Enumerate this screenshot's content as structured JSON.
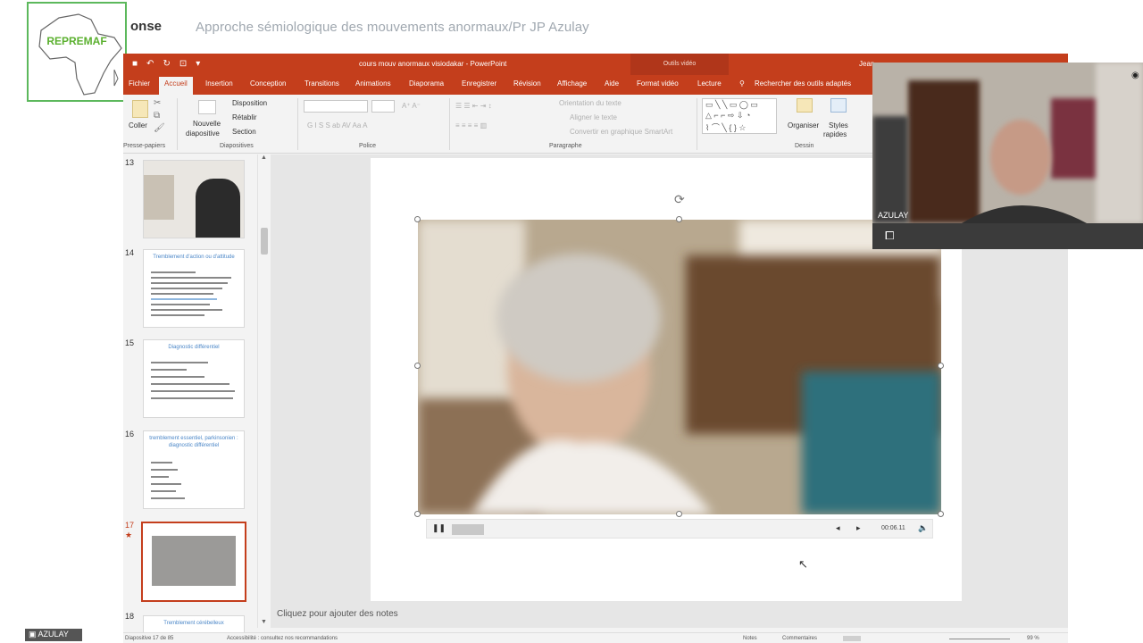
{
  "meeting": {
    "logo_text": "REPREMAF",
    "brand_fragment": "onse",
    "title": "Approche sémiologique des mouvements anormaux/Pr JP Azulay"
  },
  "powerpoint": {
    "window_title": "cours mouv anormaux visiodakar  -  PowerPoint",
    "contextual_tool": "Outils vidéo",
    "user_fragment": "Jean",
    "tabs": [
      {
        "label": "Fichier"
      },
      {
        "label": "Accueil"
      },
      {
        "label": "Insertion"
      },
      {
        "label": "Conception"
      },
      {
        "label": "Transitions"
      },
      {
        "label": "Animations"
      },
      {
        "label": "Diaporama"
      },
      {
        "label": "Enregistrer"
      },
      {
        "label": "Révision"
      },
      {
        "label": "Affichage"
      },
      {
        "label": "Aide"
      },
      {
        "label": "Format vidéo"
      },
      {
        "label": "Lecture"
      },
      {
        "label": "Rechercher des outils adaptés"
      }
    ],
    "ribbon": {
      "paste": "Coller",
      "new_slide_1": "Nouvelle",
      "new_slide_2": "diapositive",
      "layout": "Disposition",
      "reset": "Rétablir",
      "section": "Section",
      "text_direction": "Orientation du texte",
      "align_text": "Aligner le texte",
      "smartart": "Convertir en graphique SmartArt",
      "arrange": "Organiser",
      "quick_styles_1": "Styles",
      "quick_styles_2": "rapides",
      "groups": {
        "clipboard": "Presse-papiers",
        "slides": "Diapositives",
        "font": "Police",
        "paragraph": "Paragraphe",
        "drawing": "Dessin"
      }
    },
    "thumbnails": [
      {
        "number": "13",
        "title": ""
      },
      {
        "number": "14",
        "title": "Tremblement d'action ou d'attitude"
      },
      {
        "number": "15",
        "title": "Diagnostic différentiel"
      },
      {
        "number": "16",
        "title": "tremblement essentiel, parkinsonien : diagnostic différentiel"
      },
      {
        "number": "17",
        "title": ""
      },
      {
        "number": "18",
        "title": "Tremblement cérébelleux"
      }
    ],
    "selected_thumbnail": "17",
    "video": {
      "time": "00:06.11",
      "progress_fraction": 0.07
    },
    "notes_placeholder": "Cliquez pour ajouter des notes",
    "status": {
      "slide_counter": "Diapositive 17 de 85",
      "accessibility": "Accessibilité : consultez nos recommandations",
      "notes": "Notes",
      "comments": "Commentaires",
      "zoom": "99 %"
    }
  },
  "webcam": {
    "name": "AZULAY"
  },
  "self_view": {
    "name": "AZULAY"
  },
  "colors": {
    "ppt_accent": "#c43e1c",
    "logo_green": "#5bb02f",
    "title_grey": "#a0a8b0"
  }
}
